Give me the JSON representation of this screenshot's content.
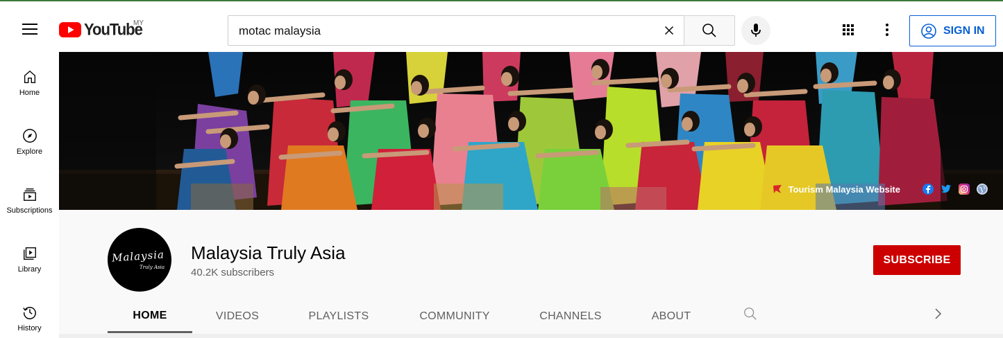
{
  "header": {
    "logo_text": "YouTube",
    "country_code": "MY",
    "search_value": "motac malaysia",
    "signin_label": "SIGN IN"
  },
  "sidebar": {
    "items": [
      {
        "label": "Home",
        "icon": "home-icon"
      },
      {
        "label": "Explore",
        "icon": "compass-icon"
      },
      {
        "label": "Subscriptions",
        "icon": "subscriptions-icon"
      },
      {
        "label": "Library",
        "icon": "library-icon"
      },
      {
        "label": "History",
        "icon": "history-icon"
      }
    ]
  },
  "banner": {
    "link_text": "Tourism Malaysia Website",
    "social": [
      "facebook-icon",
      "twitter-icon",
      "instagram-icon",
      "globe-icon"
    ]
  },
  "channel": {
    "avatar_text": "Malaysia",
    "avatar_subtext": "Truly Asia",
    "name": "Malaysia Truly Asia",
    "subscribers": "40.2K subscribers",
    "subscribe_label": "SUBSCRIBE",
    "tabs": [
      "HOME",
      "VIDEOS",
      "PLAYLISTS",
      "COMMUNITY",
      "CHANNELS",
      "ABOUT"
    ],
    "active_tab": "HOME"
  },
  "colors": {
    "brand_red": "#ff0000",
    "subscribe_red": "#cc0000",
    "link_blue": "#065fd4"
  }
}
